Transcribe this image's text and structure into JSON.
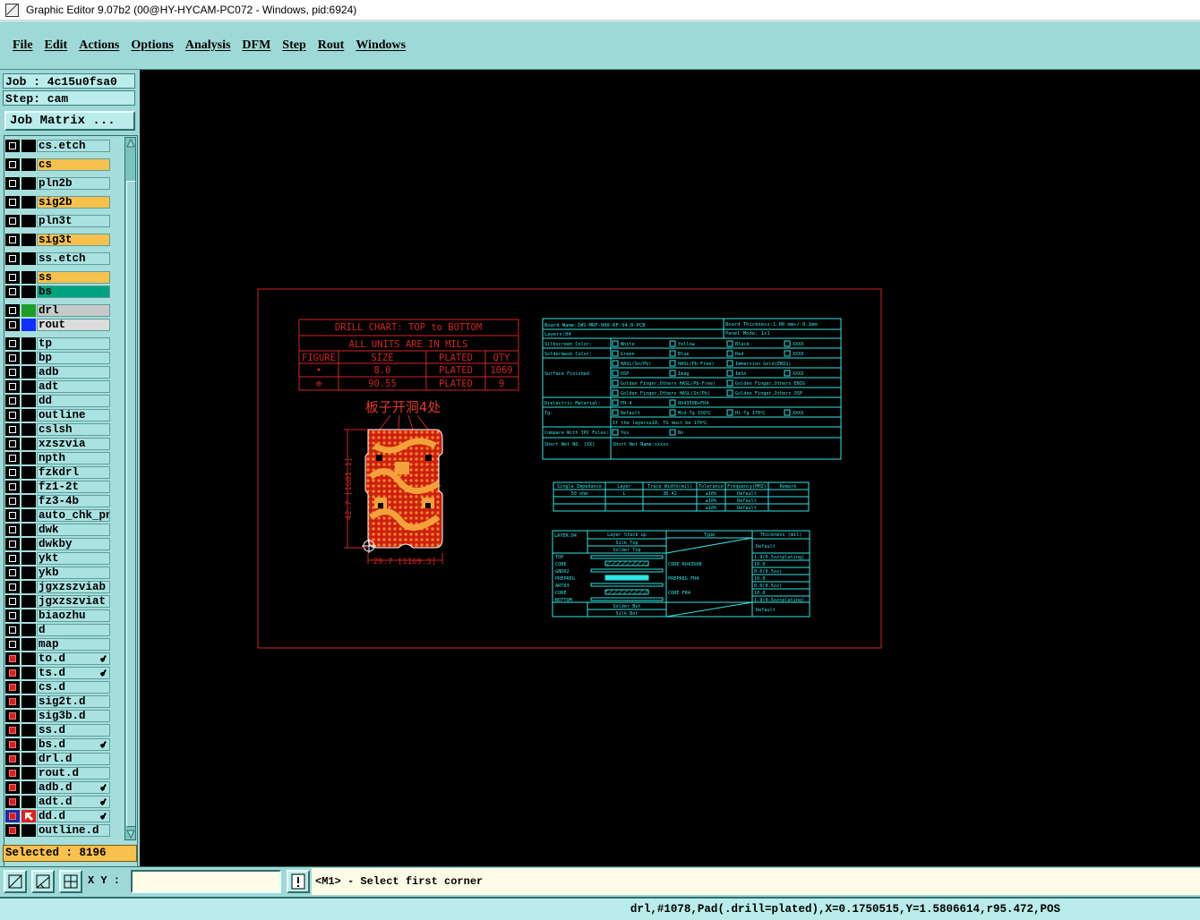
{
  "window": {
    "title": "Graphic Editor 9.07b2 (00@HY-HYCAM-PC072 - Windows, pid:6924)"
  },
  "menu": [
    "File",
    "Edit",
    "Actions",
    "Options",
    "Analysis",
    "DFM",
    "Step",
    "Rout",
    "Windows"
  ],
  "job": {
    "job_label": "Job : 4c15u0fsa0",
    "step_label": "Step: cam",
    "matrix_button": "Job Matrix ..."
  },
  "layers": [
    {
      "name": "cs.etch",
      "color": "#a9e2e0"
    },
    {
      "name": "cs",
      "color": "#f7c14d"
    },
    {
      "name": "pln2b",
      "color": "#a9e2e0"
    },
    {
      "name": "sig2b",
      "color": "#f7c14d"
    },
    {
      "name": "pln3t",
      "color": "#a9e2e0"
    },
    {
      "name": "sig3t",
      "color": "#f7c14d"
    },
    {
      "name": "ss.etch",
      "color": "#a9e2e0"
    },
    {
      "name": "ss",
      "color": "#f7c14d"
    },
    {
      "name": "bs",
      "color": "#00a37f"
    },
    {
      "name": "drl",
      "color": "#c8c8c8",
      "swatch": "#1d9e2a"
    },
    {
      "name": "rout",
      "color": "#dcdcdc",
      "swatch": "#1030ff"
    },
    {
      "name": "tp"
    },
    {
      "name": "bp"
    },
    {
      "name": "adb"
    },
    {
      "name": "adt"
    },
    {
      "name": "dd"
    },
    {
      "name": "outline"
    },
    {
      "name": "cslsh"
    },
    {
      "name": "xzszvia"
    },
    {
      "name": "npth"
    },
    {
      "name": "fzkdrl"
    },
    {
      "name": "fz1-2t"
    },
    {
      "name": "fz3-4b"
    },
    {
      "name": "auto_chk_pn"
    },
    {
      "name": "dwk"
    },
    {
      "name": "dwkby"
    },
    {
      "name": "ykt"
    },
    {
      "name": "ykb"
    },
    {
      "name": "jgxzszviab"
    },
    {
      "name": "jgxzszviat"
    },
    {
      "name": "biaozhu"
    },
    {
      "name": "d"
    },
    {
      "name": "map"
    },
    {
      "name": "to.d",
      "filled": true,
      "flag": true
    },
    {
      "name": "ts.d",
      "filled": true,
      "flag": true
    },
    {
      "name": "cs.d",
      "filled": true
    },
    {
      "name": "sig2t.d",
      "filled": true
    },
    {
      "name": "sig3b.d",
      "filled": true
    },
    {
      "name": "ss.d",
      "filled": true
    },
    {
      "name": "bs.d",
      "filled": true,
      "flag": true
    },
    {
      "name": "drl.d",
      "filled": true
    },
    {
      "name": "rout.d",
      "filled": true
    },
    {
      "name": "adb.d",
      "filled": true,
      "flag": true
    },
    {
      "name": "adt.d",
      "filled": true,
      "flag": true
    },
    {
      "name": "dd.d",
      "filled": true,
      "flag": true,
      "active": true
    },
    {
      "name": "outline.d",
      "filled": true
    }
  ],
  "selected_label": "Selected : 8196",
  "xy_label": "X Y :",
  "xy_value": "",
  "prompt": "<M1> - Select first corner",
  "status": "drl,#1078,Pad(.drill=plated),X=0.1750515,Y=1.5806614,r95.472,POS",
  "drill_chart": {
    "title": "DRILL CHART: TOP to BOTTOM",
    "units": "ALL UNITS ARE IN MILS",
    "headers": [
      "FIGURE",
      "SIZE",
      "PLATED",
      "QTY"
    ],
    "rows": [
      [
        "•",
        "8.0",
        "PLATED",
        "1069"
      ],
      [
        "⊕",
        "90.55",
        "PLATED",
        "9"
      ]
    ]
  },
  "board_note": "板子开洞4处",
  "dim_v": "42.7 [1681.1]",
  "dim_h": "29.7 [1169.3]",
  "spec_table": {
    "board_name": "Board Name:JWS-MRF-000-RF-V4.0-PCB",
    "board_thickness": "Board Thickness:1.00 mm+/-0.1mm",
    "layers": "Layers:04",
    "panel_mode": "Panel Mode: 1x1",
    "rows": [
      {
        "label": "Silkscreen Color:",
        "opts": [
          "White",
          "Yellow",
          "Black",
          "XXXX"
        ]
      },
      {
        "label": "Soldermask Color:",
        "opts": [
          "Green",
          "Blue",
          "Red",
          "XXXX"
        ]
      },
      {
        "label": "",
        "opts": [
          "HASL(Sn/Pb)",
          "HASL(Pb-Free)",
          "Immersion Gold(ENIG)"
        ]
      },
      {
        "label": "Surface Finished",
        "opts": [
          "OSP",
          "Imag",
          "ImSn",
          "XXXX"
        ]
      },
      {
        "label": "",
        "opts": [
          "Golden Finger,Others HASL(Pb-Free)",
          "Golden Finger,Others ENIG"
        ]
      },
      {
        "label": "",
        "opts": [
          "Golden Finger,Others HASL(Sn/Pb)",
          "Golden Finger,Others OSP"
        ]
      },
      {
        "label": "Dielectric Material:",
        "opts": [
          "FR-4",
          "RO4350B+FR4"
        ]
      },
      {
        "label": "Tg:",
        "opts": [
          "Default",
          "Mid-Tg 150℃",
          "Hi-Tg 170℃",
          "XXXX"
        ]
      },
      {
        "label": "",
        "opts": [
          "If the layers≥10, TG must be 170℃"
        ]
      },
      {
        "label": "Compare With IPC Files:",
        "opts": [
          "Yes",
          "No"
        ]
      },
      {
        "label": "Short Net NO. [XX]",
        "opts": [
          "Short Net Name:xxxxx"
        ]
      }
    ]
  },
  "impedance_table": {
    "headers": [
      "Single Impedance",
      "Layer",
      "Trace Width(mil)",
      "Tolerance",
      "Frequency(MHZ)",
      "Remark"
    ],
    "rows": [
      [
        "50 ohm",
        "L",
        "36.42",
        "±10%",
        "Default",
        ""
      ],
      [
        "",
        "",
        "",
        "±10%",
        "Default",
        ""
      ],
      [
        "",
        "",
        "",
        "±10%",
        "Default",
        ""
      ]
    ]
  },
  "stackup_table": {
    "layer_count": "LAYER:04",
    "header_stackup": "Layer Stack up",
    "header_type": "Type",
    "header_thickness": "Thickness (mil)",
    "silk_top": "Silk Top",
    "mask_top": "Solder Top",
    "default": "Default",
    "layers": [
      {
        "name": "TOP",
        "type": "",
        "thickness": "1.9(0.5oz+plating)"
      },
      {
        "name": "CORE",
        "type": "CORE   RO4350B",
        "thickness": "10.0"
      },
      {
        "name": "GND02",
        "type": "",
        "thickness": "0.6(0.5oz)"
      },
      {
        "name": "PREPREG",
        "type": "PREPREG  FR4",
        "thickness": "10.0"
      },
      {
        "name": "ART03",
        "type": "",
        "thickness": "0.6(0.5oz)"
      },
      {
        "name": "CORE",
        "type": "CORE    FR4",
        "thickness": "10.0"
      },
      {
        "name": "BOTTOM",
        "type": "",
        "thickness": "1.9(0.5oz+plating)"
      }
    ],
    "mask_bot": "Solder Bot",
    "silk_bot": "Silk Bot",
    "default_bottom": "Default"
  }
}
